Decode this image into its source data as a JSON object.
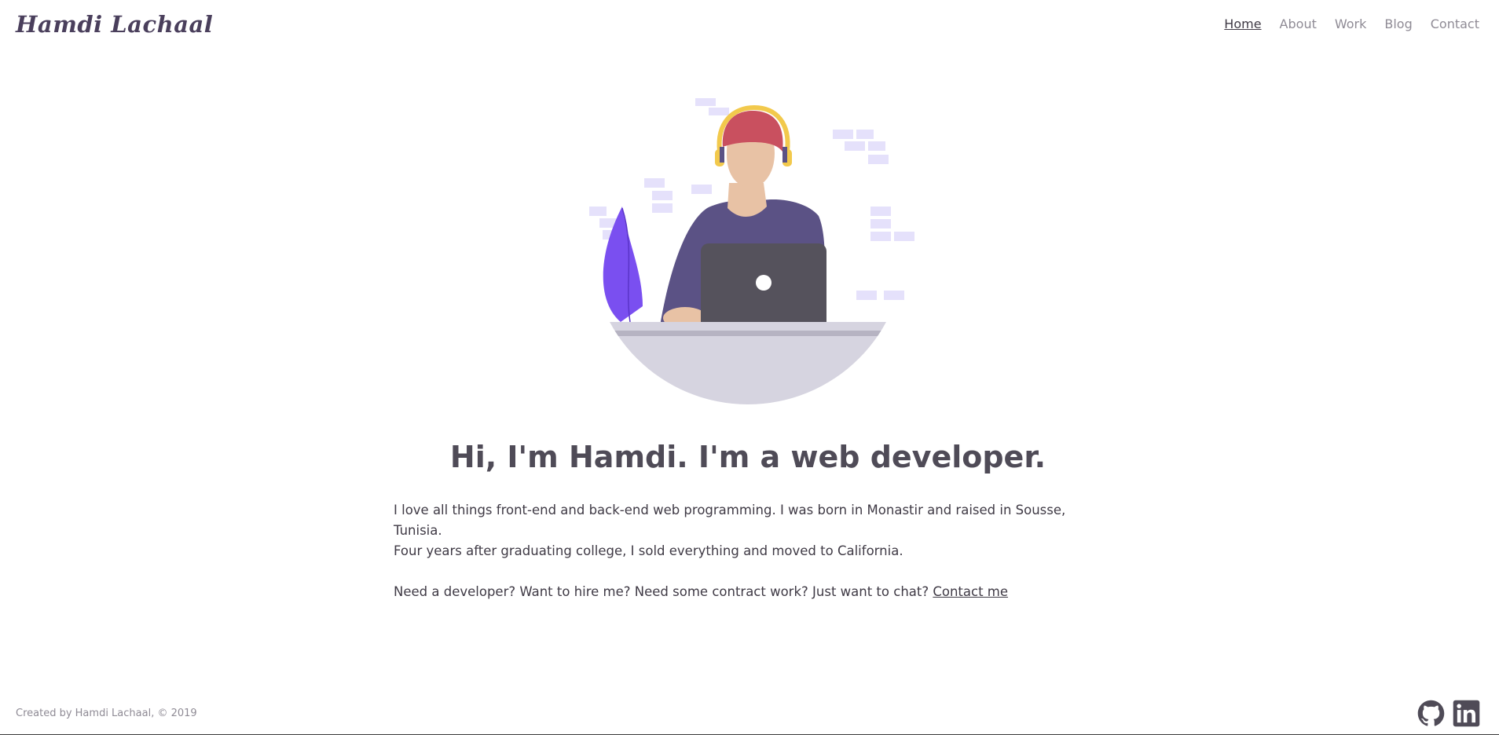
{
  "header": {
    "brand": "Hamdi Lachaal",
    "nav": [
      {
        "label": "Home"
      },
      {
        "label": "About"
      },
      {
        "label": "Work"
      },
      {
        "label": "Blog"
      },
      {
        "label": "Contact"
      }
    ]
  },
  "hero": {
    "illustration_icon": "developer-at-laptop-illustration"
  },
  "main": {
    "headline": "Hi, I'm Hamdi. I'm a web developer.",
    "intro_line1": "I love all things front-end and back-end web programming. I was born in Monastir and raised in Sousse, Tunisia.",
    "intro_line2": "Four years after graduating college, I sold everything and moved to California.",
    "cta_text": "Need a developer? Want to hire me? Need some contract work? Just want to chat? ",
    "cta_link": "Contact me"
  },
  "footer": {
    "credit": "Created by Hamdi Lachaal, © 2019",
    "social": [
      {
        "icon": "github-icon"
      },
      {
        "icon": "linkedin-icon"
      }
    ]
  },
  "colors": {
    "brand": "#4a3f5c",
    "nav_inactive": "#8f8b95",
    "shirt": "#5b5285",
    "hat": "#c9505f",
    "headphones": "#f2c94c",
    "plant": "#7a4ff0",
    "desk": "#d6d4e0",
    "laptop": "#55525c",
    "bricks": "#e5e1fb"
  }
}
